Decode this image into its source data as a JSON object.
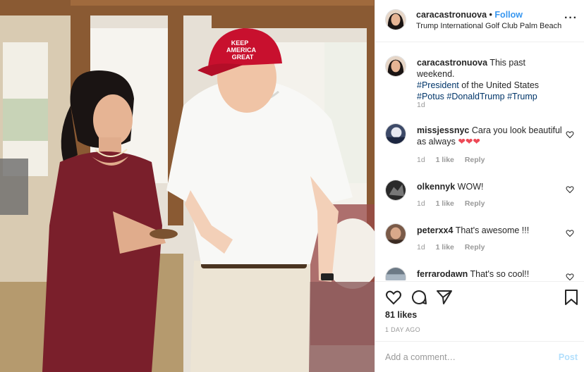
{
  "header": {
    "username": "caracastronuova",
    "separator": "•",
    "follow_label": "Follow",
    "location": "Trump International Golf Club Palm Beach",
    "more_label": "···"
  },
  "caption": {
    "username": "caracastronuova",
    "text": "This past weekend.",
    "tag1": "#President",
    "text2": "of the United States",
    "tag2": "#Potus",
    "tag3": "#DonaldTrump",
    "tag4": "#Trump",
    "time": "1d"
  },
  "comments": [
    {
      "username": "missjessnyc",
      "text": "Cara you look beautiful as always",
      "emoji": "❤❤❤",
      "time": "1d",
      "likes": "1 like",
      "reply": "Reply"
    },
    {
      "username": "olkennyk",
      "text": "WOW!",
      "time": "1d",
      "likes": "1 like",
      "reply": "Reply"
    },
    {
      "username": "peterxx4",
      "text": "That's awesome !!!",
      "time": "1d",
      "likes": "1 like",
      "reply": "Reply"
    },
    {
      "username": "ferrarodawn",
      "text": "That's so cool!!"
    }
  ],
  "actions": {
    "like_icon": "heart-icon",
    "comment_icon": "comment-icon",
    "share_icon": "share-icon",
    "save_icon": "bookmark-icon",
    "likes_count": "81 likes",
    "timestamp": "1 DAY AGO"
  },
  "add_comment": {
    "placeholder": "Add a comment…",
    "post_label": "Post"
  },
  "photo": {
    "cap_text_1": "KEEP",
    "cap_text_2": "AMERICA",
    "cap_text_3": "GREAT"
  },
  "colors": {
    "link": "#3897f0",
    "hashtag": "#003569",
    "muted": "#999999",
    "post_disabled": "#b2dffc",
    "heart": "#ed4956",
    "cap_red": "#c8102e",
    "dress": "#7a1f2b"
  }
}
